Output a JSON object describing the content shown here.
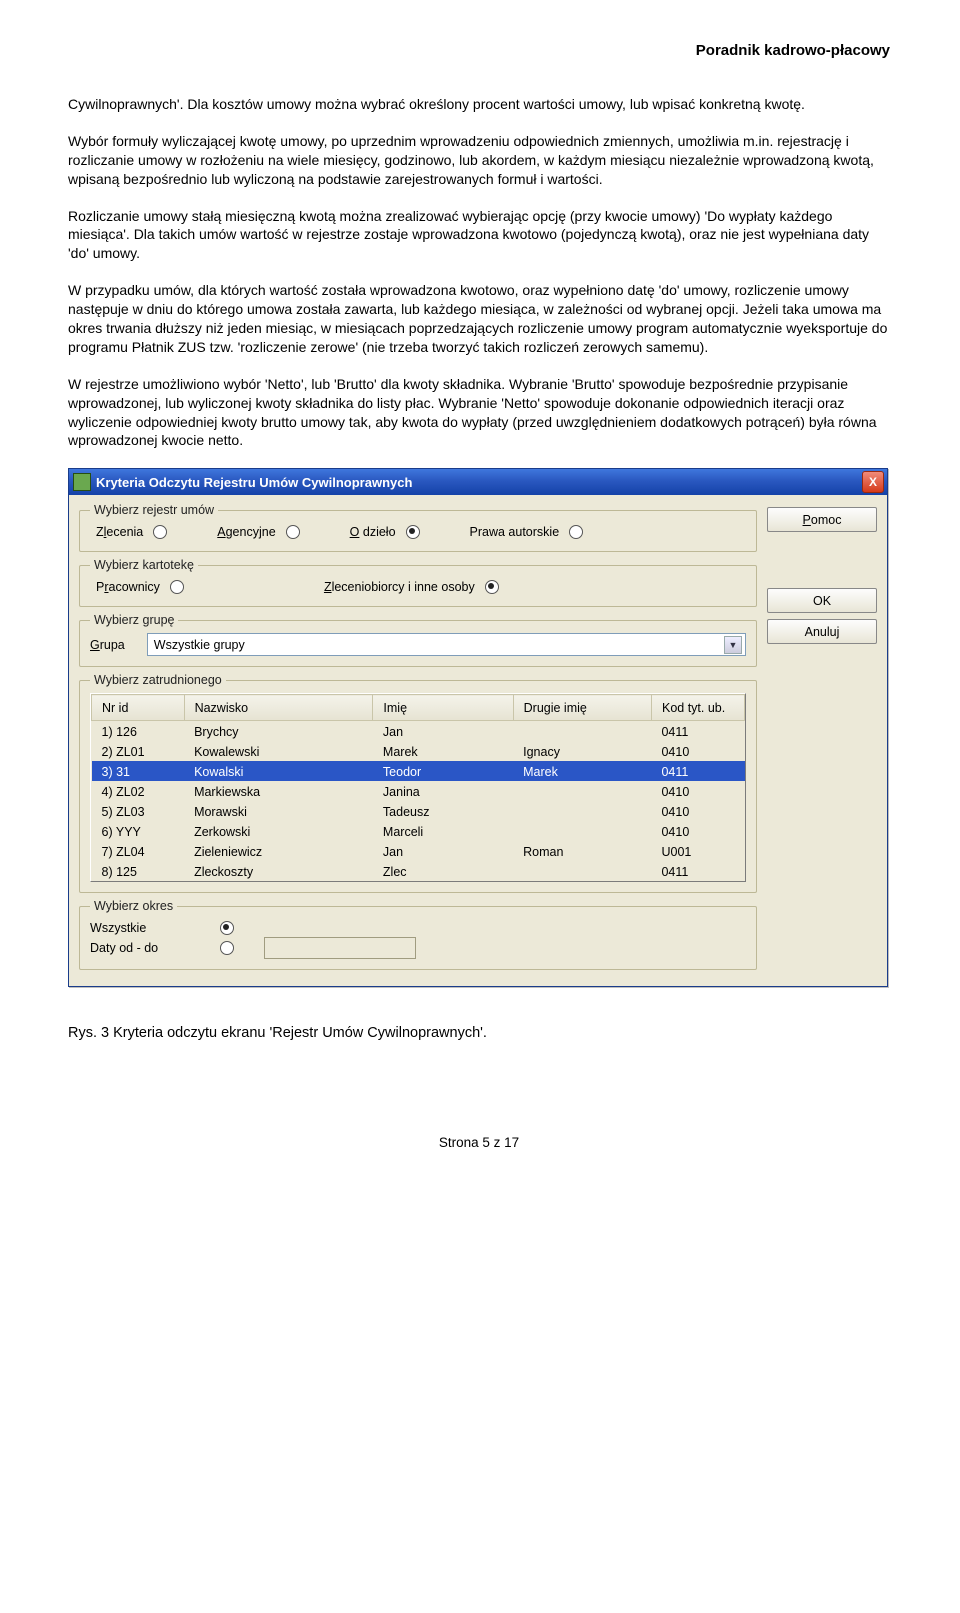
{
  "header": "Poradnik kadrowo-płacowy",
  "paragraphs": {
    "p1": "Cywilnoprawnych'. Dla kosztów umowy można wybrać określony procent wartości umowy, lub wpisać konkretną kwotę.",
    "p2": "Wybór formuły wyliczającej kwotę umowy, po uprzednim wprowadzeniu odpowiednich zmiennych, umożliwia m.in. rejestrację i rozliczanie umowy w rozłożeniu na wiele miesięcy, godzinowo, lub akordem, w każdym miesiącu niezależnie wprowadzoną kwotą, wpisaną bezpośrednio lub wyliczoną na podstawie zarejestrowanych formuł i wartości.",
    "p3": "Rozliczanie umowy stałą miesięczną kwotą można zrealizować wybierając opcję (przy kwocie umowy) 'Do wypłaty każdego miesiąca'. Dla takich umów wartość w rejestrze zostaje wprowadzona kwotowo (pojedynczą kwotą), oraz nie jest wypełniana daty 'do' umowy.",
    "p4": "W przypadku umów, dla których wartość została wprowadzona kwotowo, oraz wypełniono datę 'do' umowy, rozliczenie umowy następuje w dniu do którego umowa została zawarta, lub każdego miesiąca, w zależności od wybranej opcji. Jeżeli taka umowa ma okres trwania dłuższy niż jeden miesiąc, w miesiącach poprzedzających rozliczenie umowy program automatycznie wyeksportuje do programu Płatnik ZUS tzw. 'rozliczenie zerowe' (nie trzeba tworzyć takich rozliczeń zerowych samemu).",
    "p5": "W rejestrze umożliwiono wybór 'Netto', lub 'Brutto' dla kwoty składnika. Wybranie 'Brutto' spowoduje bezpośrednie przypisanie wprowadzonej, lub wyliczonej kwoty składnika do listy płac. Wybranie 'Netto' spowoduje dokonanie odpowiednich iteracji oraz wyliczenie odpowiedniej kwoty brutto umowy tak, aby kwota do wypłaty (przed uwzględnieniem dodatkowych potrąceń) była równa wprowadzonej kwocie netto."
  },
  "dialog": {
    "title": "Kryteria Odczytu Rejestru Umów Cywilnoprawnych",
    "close": "X",
    "buttons": {
      "help": "Pomoc",
      "ok": "OK",
      "cancel": "Anuluj"
    },
    "fs1": {
      "legend": "Wybierz rejestr umów",
      "opts": [
        "Zlecenia",
        "Agencyjne",
        "O dzieło",
        "Prawa autorskie"
      ],
      "underIdx": [
        1,
        0,
        0,
        null
      ],
      "checked": 2
    },
    "fs2": {
      "legend": "Wybierz kartotekę",
      "opts": [
        "Pracownicy",
        "Zleceniobiorcy i inne osoby"
      ],
      "checked": 1
    },
    "fs3": {
      "legend": "Wybierz grupę",
      "label": "Grupa",
      "value": "Wszystkie grupy"
    },
    "fs4": {
      "legend": "Wybierz zatrudnionego",
      "headers": [
        "Nr id",
        "Nazwisko",
        "Imię",
        "Drugie imię",
        "Kod tyt. ub."
      ],
      "rows": [
        {
          "n": "1) 126",
          "last": "Brychcy",
          "first": "Jan",
          "mid": "",
          "code": "0411"
        },
        {
          "n": "2) ZL01",
          "last": "Kowalewski",
          "first": "Marek",
          "mid": "Ignacy",
          "code": "0410"
        },
        {
          "n": "3) 31",
          "last": "Kowalski",
          "first": "Teodor",
          "mid": "Marek",
          "code": "0411"
        },
        {
          "n": "4) ZL02",
          "last": "Markiewska",
          "first": "Janina",
          "mid": "",
          "code": "0410"
        },
        {
          "n": "5) ZL03",
          "last": "Morawski",
          "first": "Tadeusz",
          "mid": "",
          "code": "0410"
        },
        {
          "n": "6) YYY",
          "last": "Zerkowski",
          "first": "Marceli",
          "mid": "",
          "code": "0410"
        },
        {
          "n": "7) ZL04",
          "last": "Zieleniewicz",
          "first": "Jan",
          "mid": "Roman",
          "code": "U001"
        },
        {
          "n": "8) 125",
          "last": "Zleckoszty",
          "first": "Zlec",
          "mid": "",
          "code": "0411"
        }
      ],
      "selected": 2
    },
    "fs5": {
      "legend": "Wybierz okres",
      "opts": [
        "Wszystkie",
        "Daty od - do"
      ],
      "checked": 0
    }
  },
  "caption": "Rys. 3 Kryteria odczytu ekranu 'Rejestr Umów Cywilnoprawnych'.",
  "footer": "Strona 5 z 17"
}
